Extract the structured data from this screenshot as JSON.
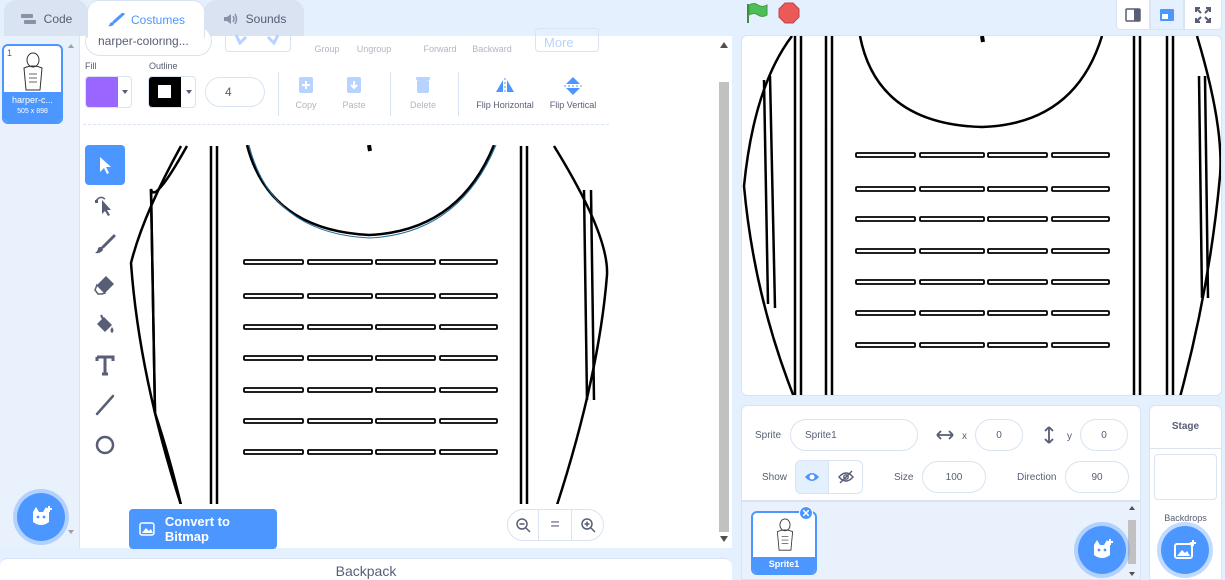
{
  "tabs": [
    {
      "label": "Code",
      "icon": "code-icon"
    },
    {
      "label": "Costumes",
      "icon": "brush-icon"
    },
    {
      "label": "Sounds",
      "icon": "speaker-icon"
    }
  ],
  "costumes": [
    {
      "number": "1",
      "name": "harper-c...",
      "size": "505 x 898"
    }
  ],
  "editor": {
    "costume_name": "harper-coloring...",
    "arrange": {
      "group": "Group",
      "ungroup": "Ungroup",
      "forward": "Forward",
      "backward": "Backward",
      "more": "More"
    },
    "fill_label": "Fill",
    "outline_label": "Outline",
    "outline_width": "4",
    "fill_color": "#9966ff",
    "outline_color": "#000000",
    "actions": {
      "copy": "Copy",
      "paste": "Paste",
      "delete": "Delete",
      "flip_h": "Flip Horizontal",
      "flip_v": "Flip Vertical"
    },
    "tools": [
      "select-icon",
      "reshape-icon",
      "brush-icon",
      "eraser-icon",
      "fill-icon",
      "text-icon",
      "line-icon",
      "circle-icon"
    ],
    "convert_label": "Convert to Bitmap",
    "zoom": {
      "out": "zoom-out-icon",
      "reset": "=",
      "in": "zoom-in-icon"
    }
  },
  "backpack": {
    "label": "Backpack"
  },
  "sprite": {
    "sprite_label": "Sprite",
    "name": "Sprite1",
    "x_label": "x",
    "x": "0",
    "y_label": "y",
    "y": "0",
    "show_label": "Show",
    "size_label": "Size",
    "size": "100",
    "direction_label": "Direction",
    "direction": "90"
  },
  "sprites": [
    {
      "name": "Sprite1"
    }
  ],
  "stage_panel": {
    "title": "Stage",
    "backdrops_label": "Backdrops"
  },
  "colors": {
    "accent": "#4c97ff",
    "green_flag": "#4cbf56",
    "stop": "#ec5959"
  }
}
